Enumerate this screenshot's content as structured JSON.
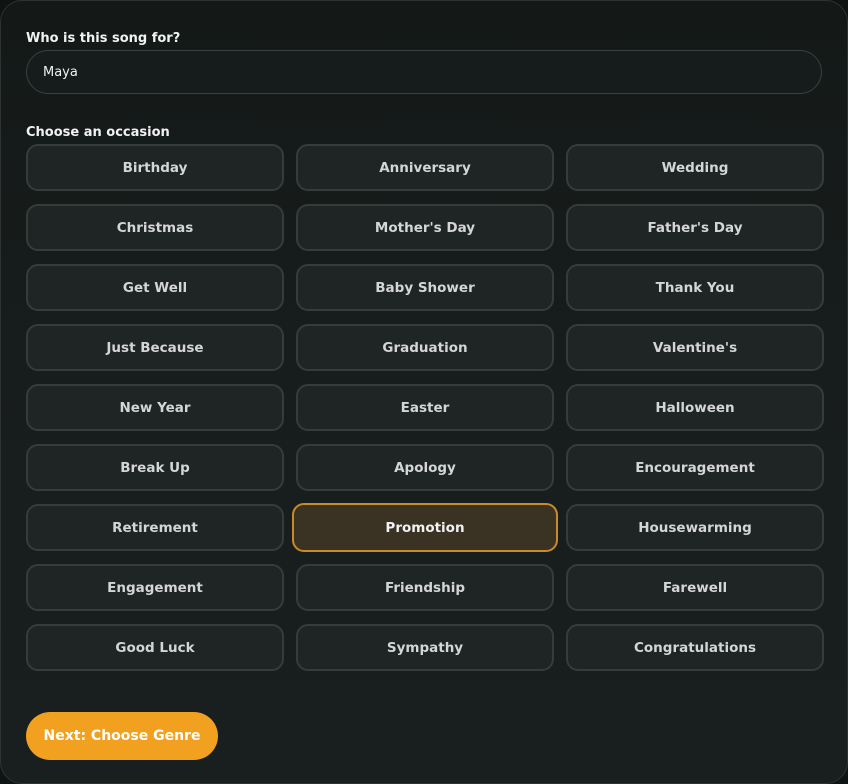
{
  "form": {
    "recipient_label": "Who is this song for?",
    "recipient_value": "Maya",
    "occasion_label": "Choose an occasion",
    "selected_occasion": "Promotion",
    "occasions": [
      "Birthday",
      "Anniversary",
      "Wedding",
      "Christmas",
      "Mother's Day",
      "Father's Day",
      "Get Well",
      "Baby Shower",
      "Thank You",
      "Just Because",
      "Graduation",
      "Valentine's",
      "New Year",
      "Easter",
      "Halloween",
      "Break Up",
      "Apology",
      "Encouragement",
      "Retirement",
      "Promotion",
      "Housewarming",
      "Engagement",
      "Friendship",
      "Farewell",
      "Good Luck",
      "Sympathy",
      "Congratulations"
    ],
    "next_label": "Next: Choose Genre"
  },
  "colors": {
    "accent": "#f2a020",
    "selected_border": "#c88a2a",
    "background": "#141918"
  }
}
